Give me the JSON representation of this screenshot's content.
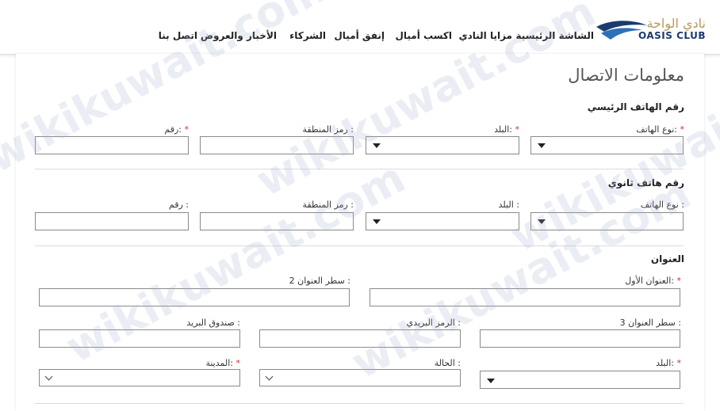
{
  "logo": {
    "arabic": "نادي الواحة",
    "english": "OASIS CLUB"
  },
  "nav": [
    {
      "label": "الشاشة الرئيسية"
    },
    {
      "label": "مزايا النادي"
    },
    {
      "label": "اكسب أميال"
    },
    {
      "label": "إنفق أميال"
    },
    {
      "label": "الشركاء"
    },
    {
      "label": "الأخبار والعروض"
    },
    {
      "label": "اتصل بنا"
    }
  ],
  "page_title": "معلومات الاتصال",
  "primary_phone": {
    "title": "رقم الهاتف الرئيسي",
    "phone_type": "نوع الهاتف:",
    "country": "البلد:",
    "area_code": "رمز المنطقة :",
    "number": "رقم:"
  },
  "secondary_phone": {
    "title": "رقم هاتف ثانوي",
    "phone_type": "نوع الهاتف :",
    "country": "البلد :",
    "area_code": "رمز المنطقة :",
    "number": "رقم :"
  },
  "address": {
    "title": "العنوان",
    "line1": "العنوان الأول:",
    "line2": "سطر العنوان 2 :",
    "line3": "سطر العنوان 3 :",
    "postal_code": "الرمز البريدي :",
    "po_box": "صندوق البريد :",
    "country": "البلد:",
    "state": "الحالة :",
    "city": "المدينة:"
  },
  "required_mark": "*",
  "watermark": "wikikuwait.com",
  "colors": {
    "required": "#d32f2f",
    "brand_navy": "#1d3a6e",
    "brand_gold": "#b89a5a"
  }
}
